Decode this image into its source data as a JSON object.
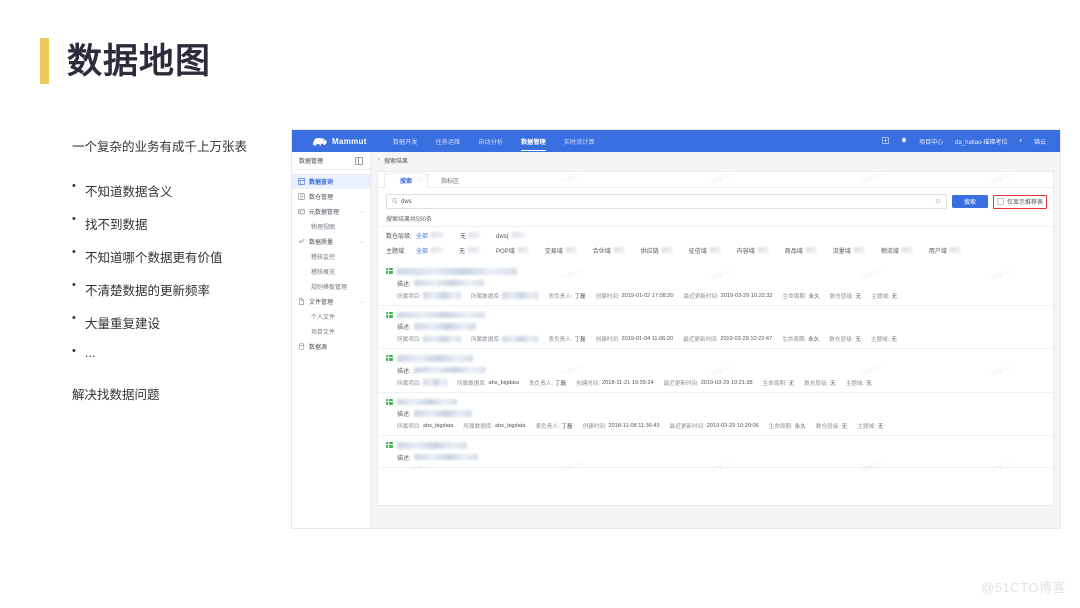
{
  "slide": {
    "title": "数据地图",
    "lead": "一个复杂的业务有成千上万张表",
    "bullets": [
      "不知道数据含义",
      "找不到数据",
      "不知道哪个数据更有价值",
      "不清楚数据的更新频率",
      "大量重复建设",
      "..."
    ],
    "closing": "解决找数据问题",
    "watermark": "@51CTO博客",
    "accent_color": "#e8c95a"
  },
  "app": {
    "brand": "Mammut",
    "brand_color": "#3a6fe0",
    "topnav": [
      {
        "label": "数据开发",
        "active": false
      },
      {
        "label": "任务运维",
        "active": false
      },
      {
        "label": "自动分析",
        "active": false
      },
      {
        "label": "数据管理",
        "active": true
      },
      {
        "label": "实时流计算",
        "active": false
      }
    ],
    "topbar_right": {
      "apps_icon": "grid-icon",
      "bell_icon": "bell-icon",
      "project_center": "项目中心",
      "project": "da_haitao-璀璨考拉",
      "caret": "▾",
      "user": "锦云"
    },
    "sidebar": {
      "title": "数据管理",
      "collapse_icon": "collapse-panel-icon",
      "items": [
        {
          "label": "数据查询",
          "icon": "search-table-icon",
          "active": true,
          "sub": false,
          "caret": ""
        },
        {
          "label": "数仓管理",
          "icon": "warehouse-icon",
          "active": false,
          "sub": false,
          "caret": ""
        },
        {
          "label": "元数据管理",
          "icon": "metadata-icon",
          "active": false,
          "sub": false,
          "caret": "⌄"
        },
        {
          "label": "物理视图",
          "icon": "",
          "active": false,
          "sub": true,
          "caret": ""
        },
        {
          "label": "数据质量",
          "icon": "quality-icon",
          "active": false,
          "sub": false,
          "caret": "⌄"
        },
        {
          "label": "稽核监控",
          "icon": "",
          "active": false,
          "sub": true,
          "caret": ""
        },
        {
          "label": "稽核概览",
          "icon": "",
          "active": false,
          "sub": true,
          "caret": ""
        },
        {
          "label": "规则模板管理",
          "icon": "",
          "active": false,
          "sub": true,
          "caret": ""
        },
        {
          "label": "文件管理",
          "icon": "file-icon",
          "active": false,
          "sub": false,
          "caret": "⌄"
        },
        {
          "label": "个人文件",
          "icon": "",
          "active": false,
          "sub": true,
          "caret": ""
        },
        {
          "label": "项目文件",
          "icon": "",
          "active": false,
          "sub": true,
          "caret": ""
        },
        {
          "label": "数据源",
          "icon": "datasource-icon",
          "active": false,
          "sub": false,
          "caret": ""
        }
      ]
    },
    "breadcrumb": {
      "back": "‹",
      "label": "搜索结果"
    },
    "tabs": [
      {
        "label": "搜索",
        "active": true
      },
      {
        "label": "指标区",
        "active": false
      }
    ],
    "search": {
      "value": "dws",
      "search_icon": "search-icon",
      "clear_icon": "clear-circle-icon",
      "button": "搜索",
      "recommend_checkbox": {
        "label": "仅显示推荐表",
        "checked": false,
        "highlight_color": "#e3342f"
      }
    },
    "result_count": "搜索结果共550条",
    "filters": [
      {
        "key": "数仓层级:",
        "options": [
          {
            "label": "全部",
            "active": true
          },
          {
            "label": "无",
            "active": false
          },
          {
            "label": "dws(",
            "active": false
          }
        ]
      },
      {
        "key": "主题域:",
        "options": [
          {
            "label": "全部",
            "active": true
          },
          {
            "label": "无",
            "active": false
          },
          {
            "label": "POP域",
            "active": false
          },
          {
            "label": "交易域",
            "active": false
          },
          {
            "label": "合伙域",
            "active": false
          },
          {
            "label": "供应链",
            "active": false
          },
          {
            "label": "征信域",
            "active": false
          },
          {
            "label": "内容域",
            "active": false
          },
          {
            "label": "商品域",
            "active": false
          },
          {
            "label": "流量域",
            "active": false
          },
          {
            "label": "物流域",
            "active": false
          },
          {
            "label": "用户域",
            "active": false
          }
        ]
      }
    ],
    "meta_labels": {
      "desc": "描述:",
      "project": "所属项目:",
      "database": "所属数据库:",
      "owner": "表负责人:",
      "created": "创建时间:",
      "updated": "最近更新时间:",
      "lifecycle": "生命周期:",
      "layer": "数仓层级:",
      "domain": "主题域:"
    },
    "results": [
      {
        "name_redacted": true,
        "desc_redacted": true,
        "project": "",
        "project_redacted": true,
        "database": "",
        "database_redacted": true,
        "owner": "丁磊",
        "created": "2019-01-02 17:08:20",
        "updated": "2019-03-29 10:22:32",
        "lifecycle": "永久",
        "layer": "无",
        "domain": "无"
      },
      {
        "name_redacted": true,
        "desc_redacted": true,
        "project": "",
        "project_redacted": true,
        "database": "",
        "database_redacted": true,
        "owner": "丁磊",
        "created": "2019-01-04 11:06:20",
        "updated": "2019-03-29 10:22:47",
        "lifecycle": "永久",
        "layer": "无",
        "domain": "无"
      },
      {
        "name_redacted": true,
        "desc_redacted": true,
        "project": "",
        "project_redacted": true,
        "database": "ahs_bigdata",
        "database_redacted": false,
        "owner": "丁磊",
        "created": "2018-11-21 19:39:24",
        "updated": "2019-03-29 10:21:38",
        "lifecycle": "无",
        "layer": "无",
        "domain": "无"
      },
      {
        "name_redacted": true,
        "desc_redacted": true,
        "project": "ahs_bigdata",
        "project_redacted": false,
        "database": "ahs_bigdata",
        "database_redacted": false,
        "owner": "丁磊",
        "created": "2018-11-08 11:36:43",
        "updated": "2019-03-29 10:20:06",
        "lifecycle": "永久",
        "layer": "无",
        "domain": "无"
      },
      {
        "name_redacted": true,
        "desc_redacted": true,
        "project": "",
        "project_redacted": true,
        "database": "",
        "database_redacted": true,
        "owner": "",
        "created": "",
        "updated": "",
        "lifecycle": "",
        "layer": "",
        "domain": "",
        "partial": true
      }
    ],
    "inner_watermark": "h2@.ov"
  }
}
